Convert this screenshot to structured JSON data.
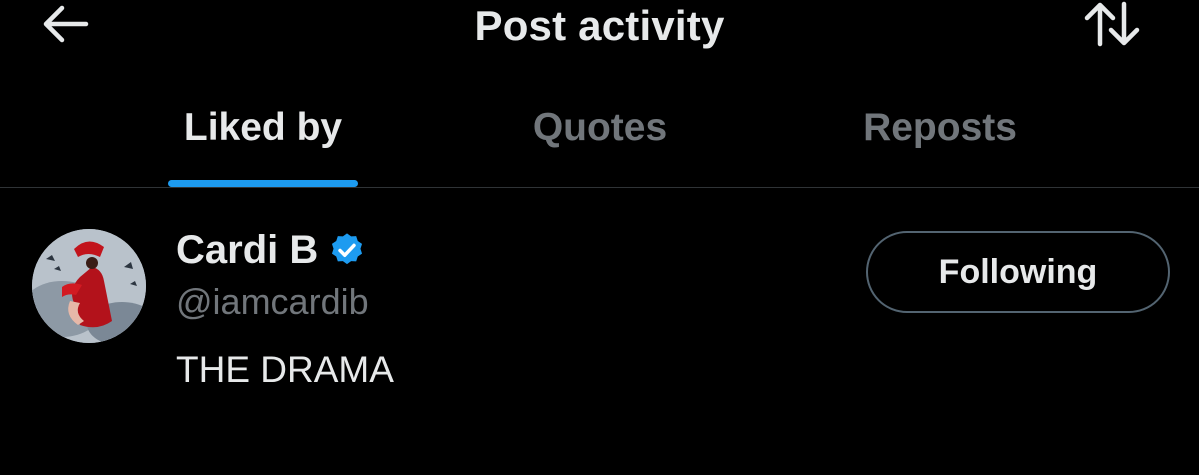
{
  "header": {
    "title": "Post activity",
    "back_icon": "arrow-left-icon",
    "sort_icon": "sort-arrows-icon"
  },
  "tabs": [
    {
      "label": "Liked by",
      "active": true
    },
    {
      "label": "Quotes",
      "active": false
    },
    {
      "label": "Reposts",
      "active": false
    }
  ],
  "users": [
    {
      "name": "Cardi B",
      "verified": true,
      "handle": "@iamcardib",
      "bio": "THE DRAMA",
      "follow_label": "Following"
    }
  ],
  "colors": {
    "background": "#000000",
    "accent": "#1d9bf0",
    "primary_text": "#e7e9ea",
    "secondary_text": "#71767b",
    "border": "#2f3336"
  }
}
